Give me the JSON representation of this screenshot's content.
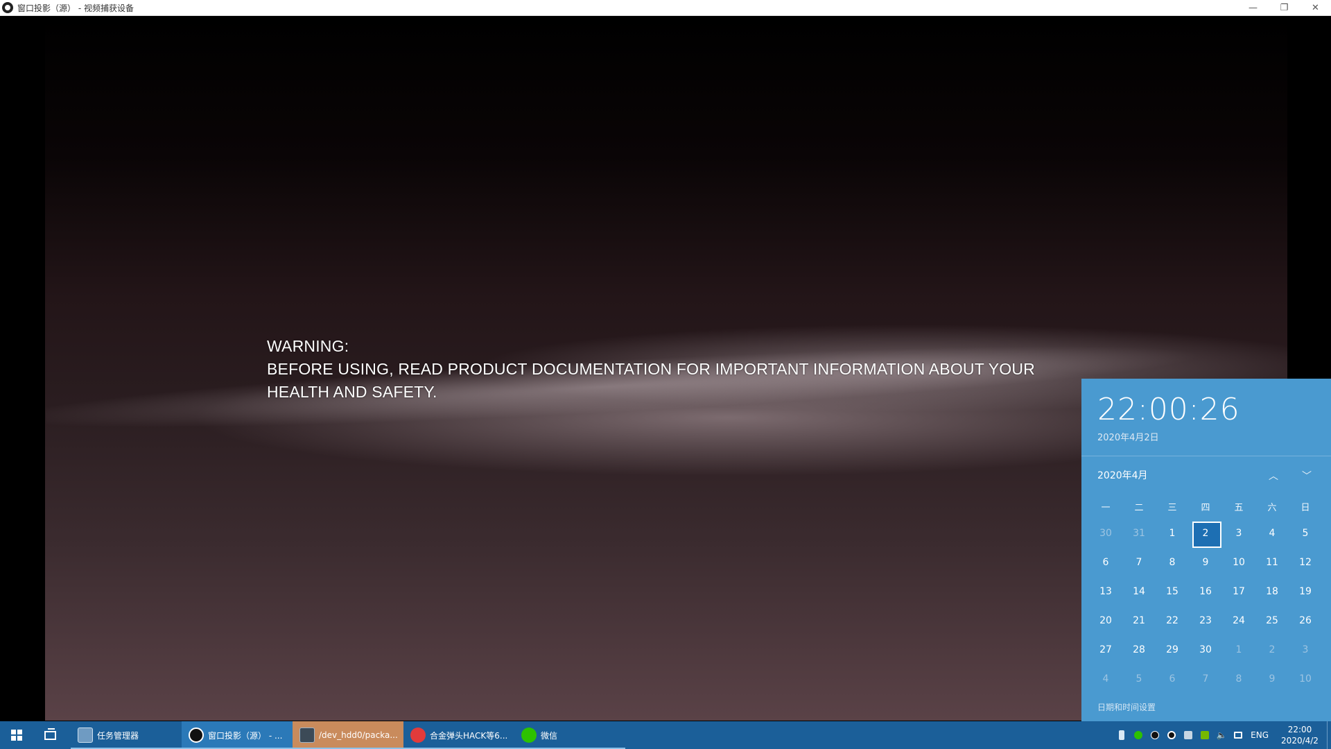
{
  "window": {
    "title": "窗口投影（源） - 视频捕获设备",
    "controls": {
      "minimize": "—",
      "restore": "❐",
      "close": "✕"
    }
  },
  "video": {
    "warning_line1": "WARNING:",
    "warning_line2": "BEFORE USING, READ PRODUCT DOCUMENTATION FOR IMPORTANT INFORMATION ABOUT YOUR HEALTH AND SAFETY."
  },
  "calendar": {
    "time": "22:00:26",
    "date_long": "2020年4月2日",
    "month_label": "2020年4月",
    "nav_up": "︿",
    "nav_down": "﹀",
    "weekdays": [
      "一",
      "二",
      "三",
      "四",
      "五",
      "六",
      "日"
    ],
    "weeks": [
      [
        {
          "d": "30",
          "dim": true
        },
        {
          "d": "31",
          "dim": true
        },
        {
          "d": "1"
        },
        {
          "d": "2",
          "today": true
        },
        {
          "d": "3"
        },
        {
          "d": "4"
        },
        {
          "d": "5"
        }
      ],
      [
        {
          "d": "6"
        },
        {
          "d": "7"
        },
        {
          "d": "8"
        },
        {
          "d": "9"
        },
        {
          "d": "10"
        },
        {
          "d": "11"
        },
        {
          "d": "12"
        }
      ],
      [
        {
          "d": "13"
        },
        {
          "d": "14"
        },
        {
          "d": "15"
        },
        {
          "d": "16"
        },
        {
          "d": "17"
        },
        {
          "d": "18"
        },
        {
          "d": "19"
        }
      ],
      [
        {
          "d": "20"
        },
        {
          "d": "21"
        },
        {
          "d": "22"
        },
        {
          "d": "23"
        },
        {
          "d": "24"
        },
        {
          "d": "25"
        },
        {
          "d": "26"
        }
      ],
      [
        {
          "d": "27"
        },
        {
          "d": "28"
        },
        {
          "d": "29"
        },
        {
          "d": "30"
        },
        {
          "d": "1",
          "dim": true
        },
        {
          "d": "2",
          "dim": true
        },
        {
          "d": "3",
          "dim": true
        }
      ],
      [
        {
          "d": "4",
          "dim": true
        },
        {
          "d": "5",
          "dim": true
        },
        {
          "d": "6",
          "dim": true
        },
        {
          "d": "7",
          "dim": true
        },
        {
          "d": "8",
          "dim": true
        },
        {
          "d": "9",
          "dim": true
        },
        {
          "d": "10",
          "dim": true
        }
      ]
    ],
    "settings_link": "日期和时间设置",
    "accent_color": "#4a9ad0"
  },
  "taskbar": {
    "tasks": [
      {
        "label": "任务管理器",
        "icon": "task-manager-icon",
        "state": "normal"
      },
      {
        "label": "窗口投影（源） - ...",
        "icon": "obs-icon",
        "state": "active"
      },
      {
        "label": "/dev_hdd0/packa...",
        "icon": "terminal-icon",
        "state": "highlight"
      },
      {
        "label": "合金弹头HACK等6...",
        "icon": "game-icon",
        "state": "normal"
      },
      {
        "label": "微信",
        "icon": "wechat-icon",
        "state": "normal"
      }
    ],
    "tray": {
      "language": "ENG",
      "time": "22:00",
      "date": "2020/4/2"
    }
  }
}
